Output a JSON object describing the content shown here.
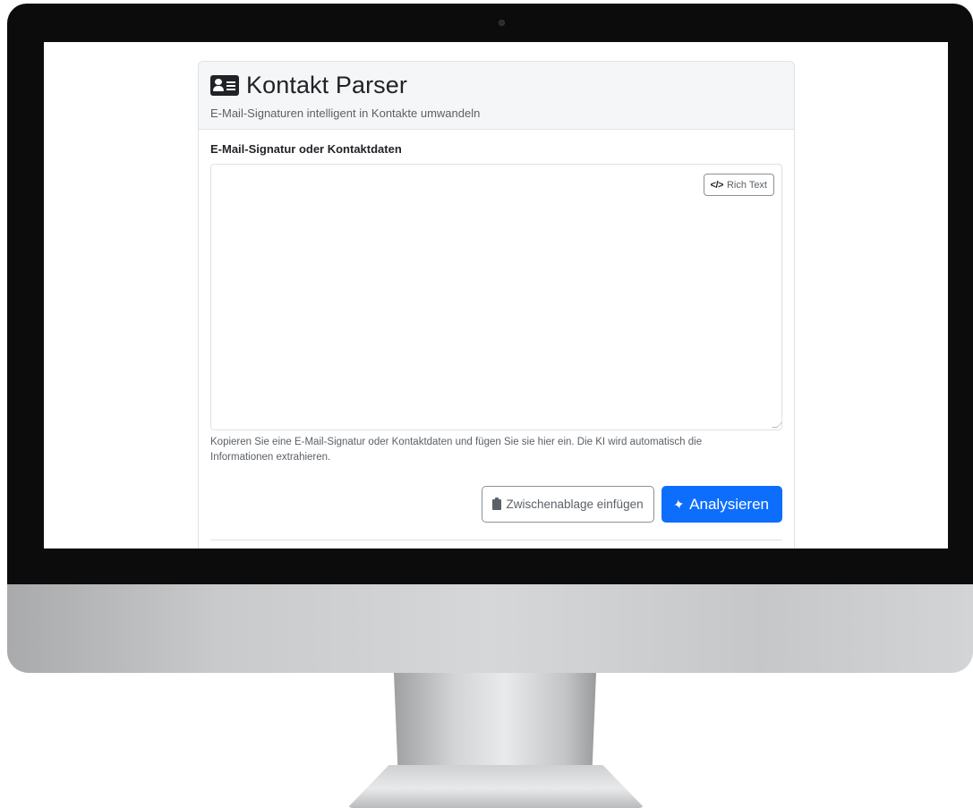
{
  "app": {
    "title": "Kontakt Parser",
    "subtitle": "E-Mail-Signaturen intelligent in Kontakte umwandeln",
    "header_icon": "id-card-icon"
  },
  "form": {
    "field_label": "E-Mail-Signatur oder Kontaktdaten",
    "textarea_value": "",
    "rich_text_button": {
      "label": "Rich Text",
      "icon": "code-icon"
    },
    "help_text": "Kopieren Sie eine E-Mail-Signatur oder Kontaktdaten und fügen Sie sie hier ein. Die KI wird automatisch die Informationen extrahieren."
  },
  "actions": {
    "paste_button": {
      "label": "Zwischenablage einfügen",
      "icon": "clipboard-icon"
    },
    "analyze_button": {
      "label": "Analysieren",
      "icon": "magic-wand-icon"
    }
  },
  "colors": {
    "primary": "#0d6efd",
    "text": "#1f2226",
    "muted": "#5b6168",
    "border": "#dfe1e4"
  }
}
